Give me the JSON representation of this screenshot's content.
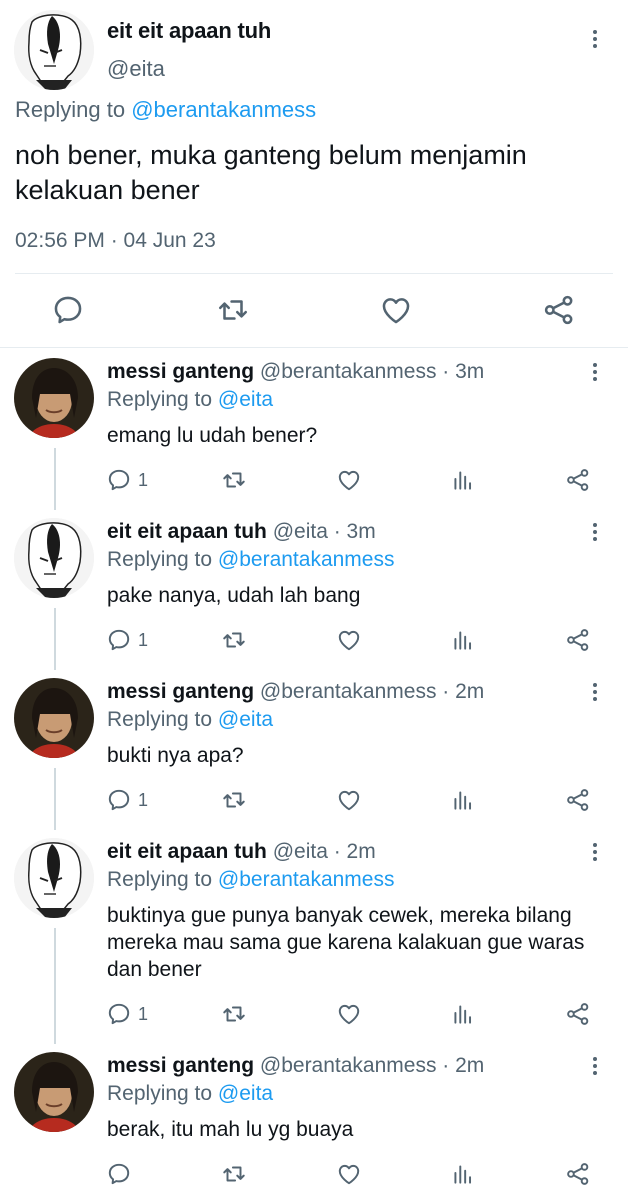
{
  "main_tweet": {
    "name": "eit eit apaan tuh",
    "handle": "@eita",
    "replying_prefix": "Replying to ",
    "replying_to": "@berantakanmess",
    "text": "noh bener, muka ganteng belum menjamin kelakuan bener",
    "timestamp": "02:56 PM · 04 Jun 23",
    "actions": [
      "reply-icon",
      "retweet-icon",
      "like-icon",
      "share-icon"
    ]
  },
  "replies": [
    {
      "name": "messi ganteng",
      "handle": "@berantakanmess · 3m",
      "replying_prefix": "Replying to ",
      "replying_to": "@eita",
      "text": "emang lu udah bener?",
      "reply_count": "1",
      "avatar": "messi"
    },
    {
      "name": "eit eit apaan tuh",
      "handle": "@eita · 3m",
      "replying_prefix": "Replying to ",
      "replying_to": "@berantakanmess",
      "text": "pake nanya, udah lah bang",
      "reply_count": "1",
      "avatar": "anime"
    },
    {
      "name": "messi ganteng",
      "handle": "@berantakanmess · 2m",
      "replying_prefix": "Replying to ",
      "replying_to": "@eita",
      "text": "bukti nya apa?",
      "reply_count": "1",
      "avatar": "messi"
    },
    {
      "name": "eit eit apaan tuh",
      "handle": "@eita · 2m",
      "replying_prefix": "Replying to ",
      "replying_to": "@berantakanmess",
      "text": "buktinya gue punya banyak cewek, mereka bilang mereka mau sama gue karena kalakuan gue waras dan bener",
      "reply_count": "1",
      "avatar": "anime"
    },
    {
      "name": "messi ganteng",
      "handle": "@berantakanmess · 2m",
      "replying_prefix": "Replying to ",
      "replying_to": "@eita",
      "text": "berak, itu mah lu yg buaya",
      "reply_count": "",
      "avatar": "messi"
    }
  ],
  "colors": {
    "link": "#1d9bf0",
    "secondary_text": "#536471",
    "primary_text": "#0f1419",
    "thread_line": "#cfd9de"
  }
}
